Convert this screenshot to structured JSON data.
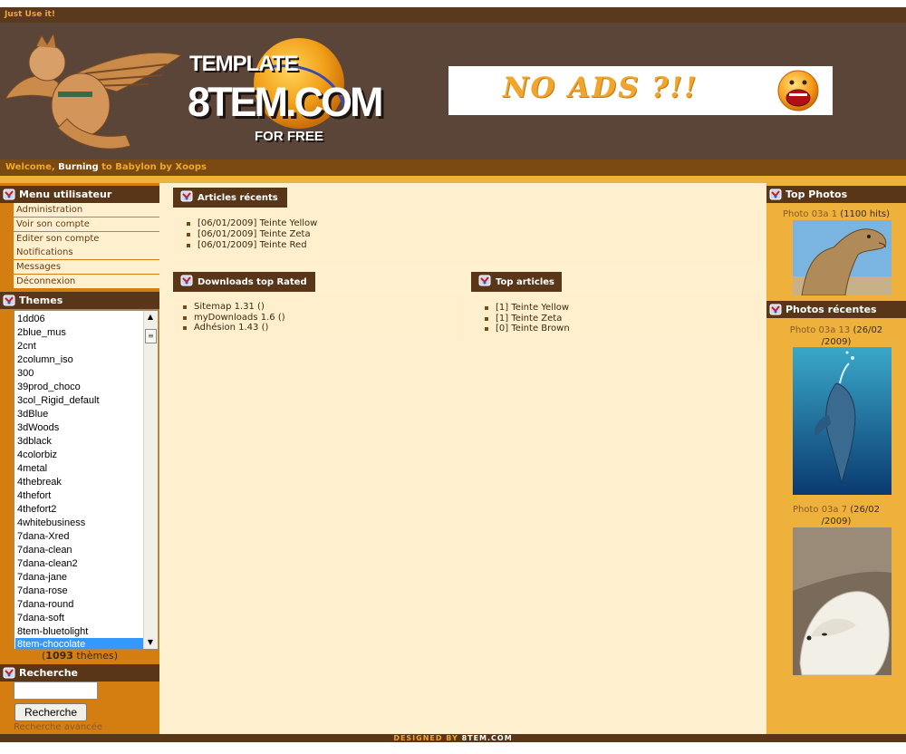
{
  "topbar": {
    "text": "Just Use it!"
  },
  "header": {
    "brand_line1": "TEMPLATE",
    "brand_line2": "8TEM.COM",
    "brand_line3": "FOR FREE",
    "ad_text": "NO ADS ?!!"
  },
  "welcome": {
    "prefix": "Welcome,",
    "username": "Burning",
    "suffix": "to Babylon by Xoops"
  },
  "user_menu": {
    "title": "Menu utilisateur",
    "items": [
      "Administration",
      "Voir son compte",
      "Editer son compte",
      "Notifications",
      "Messages",
      "Déconnexion"
    ]
  },
  "themes": {
    "title": "Themes",
    "items": [
      "1dd06",
      "2blue_mus",
      "2cnt",
      "2column_iso",
      "300",
      "39prod_choco",
      "3col_Rigid_default",
      "3dBlue",
      "3dWoods",
      "3dblack",
      "4colorbiz",
      "4metal",
      "4thebreak",
      "4thefort",
      "4thefort2",
      "4whitebusiness",
      "7dana-Xred",
      "7dana-clean",
      "7dana-clean2",
      "7dana-jane",
      "7dana-rose",
      "7dana-round",
      "7dana-soft",
      "8tem-bluetolight",
      "8tem-chocolate"
    ],
    "selected": "8tem-chocolate",
    "count": "1093",
    "count_suffix": "thèmes"
  },
  "search": {
    "title": "Recherche",
    "input_value": "",
    "button_label": "Recherche",
    "advanced_link": "Recherche avancée"
  },
  "recent_articles": {
    "title": "Articles récents",
    "items": [
      "[06/01/2009] Teinte Yellow",
      "[06/01/2009] Teinte Zeta",
      "[06/01/2009] Teinte Red"
    ]
  },
  "downloads_top_rated": {
    "title": "Downloads top Rated",
    "items": [
      "Sitemap 1.31 ()",
      "myDownloads 1.6 ()",
      "Adhésion 1.43 ()"
    ]
  },
  "top_articles": {
    "title": "Top articles",
    "items": [
      "[1] Teinte Yellow",
      "[1] Teinte Zeta",
      "[0] Teinte Brown"
    ]
  },
  "top_photos": {
    "title": "Top Photos",
    "items": [
      {
        "name": "Photo 03a 1",
        "detail": "(1100 hits)"
      }
    ]
  },
  "recent_photos": {
    "title": "Photos récentes",
    "items": [
      {
        "name": "Photo 03a 13",
        "date_a": "(26/02",
        "date_b": "/2009)"
      },
      {
        "name": "Photo 03a 7",
        "date_a": "(26/02",
        "date_b": "/2009)"
      }
    ]
  },
  "footer": {
    "prefix": "DESIGNED BY",
    "brand": "8TEM.COM"
  },
  "colors": {
    "dark_brown": "#5a3618",
    "header_brown": "#5a4538",
    "orange": "#d47e12",
    "gold": "#edb13c",
    "cream": "#fff0d0",
    "accent_text": "#f0a82a",
    "selection_blue": "#3399ff"
  }
}
